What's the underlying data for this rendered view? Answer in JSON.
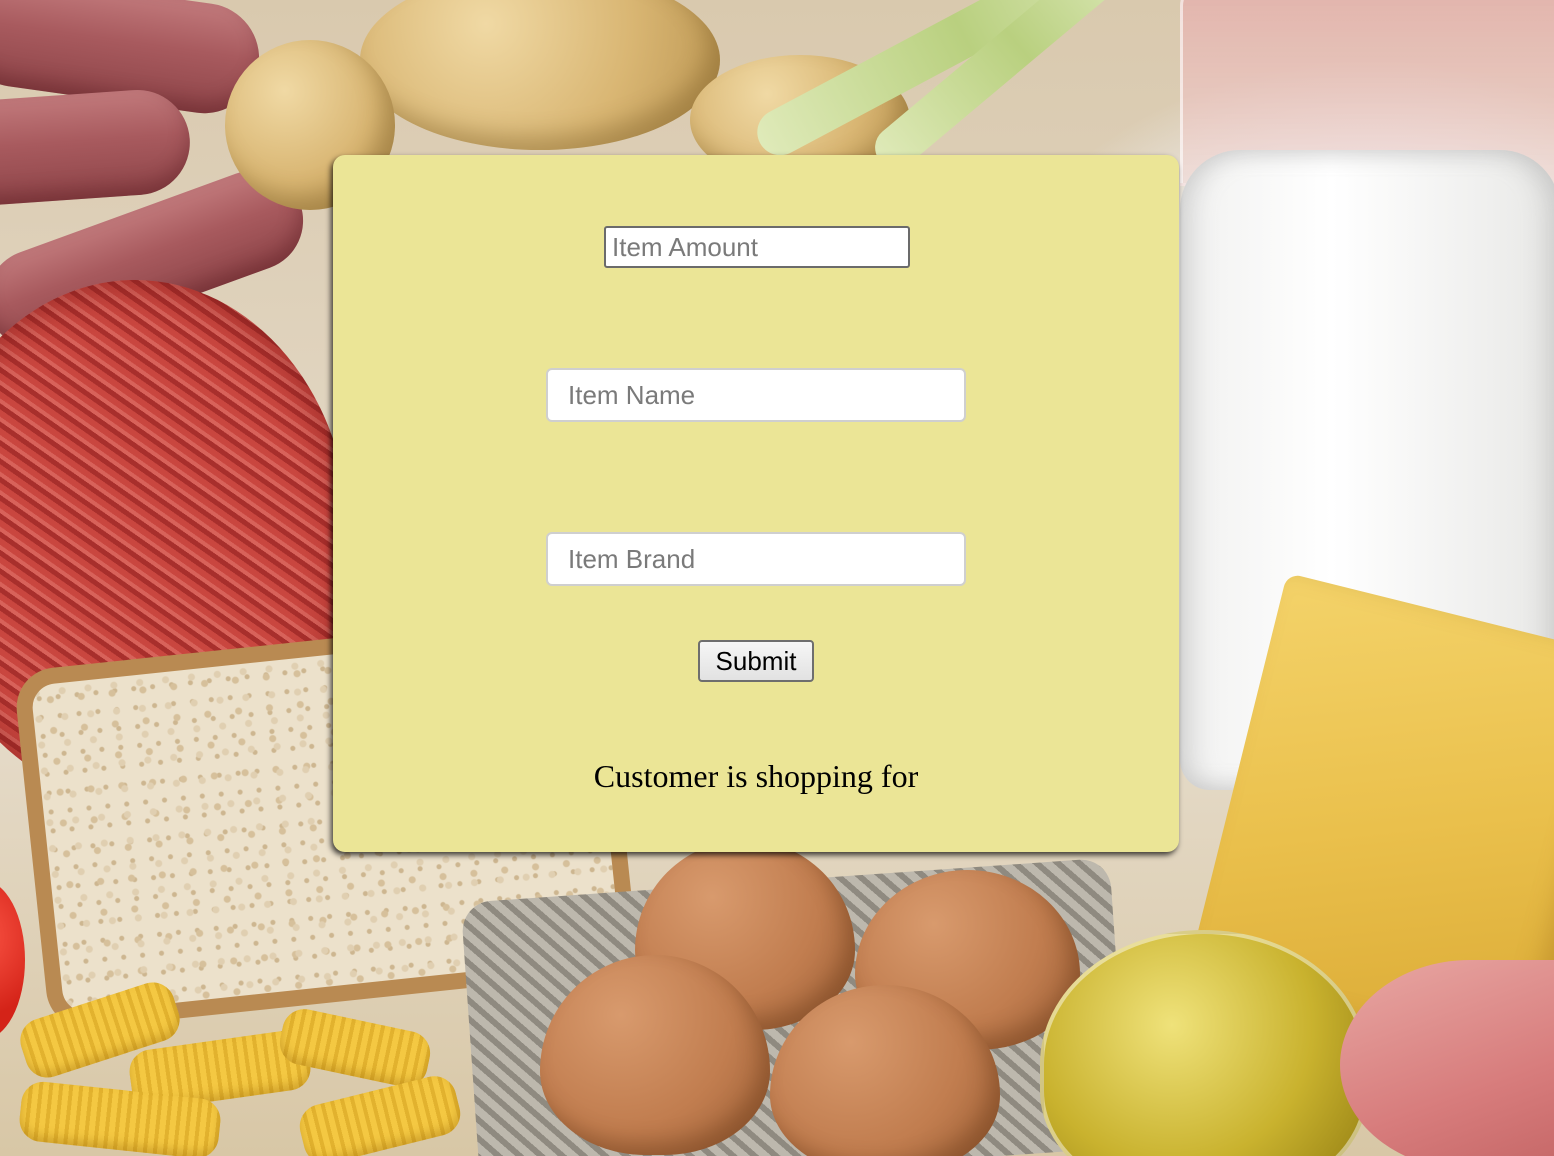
{
  "background": {
    "description_icon": "grocery-food-background"
  },
  "form": {
    "amount_placeholder": "Item Amount",
    "name_placeholder": "Item Name",
    "brand_placeholder": "Item Brand",
    "submit_label": "Submit",
    "status_text": "Customer is shopping for",
    "panel_color": "#ebe596"
  }
}
